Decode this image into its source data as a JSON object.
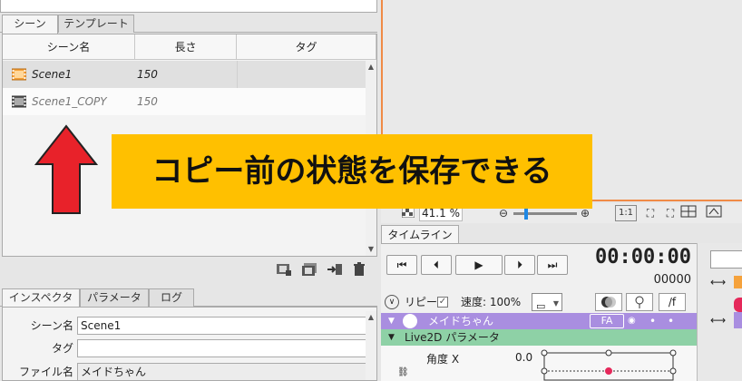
{
  "left_top": {
    "tabs": [
      {
        "label": "シーン"
      },
      {
        "label": "テンプレート"
      }
    ]
  },
  "scene_table": {
    "headers": [
      "シーン名",
      "長さ",
      "タグ"
    ],
    "rows": [
      {
        "name": "Scene1",
        "length": "150",
        "tag": ""
      },
      {
        "name": "Scene1_COPY",
        "length": "150",
        "tag": ""
      }
    ]
  },
  "scene_tools": [
    "film-add-icon",
    "film-copy-icon",
    "import-icon",
    "trash-icon"
  ],
  "inspector": {
    "tabs": [
      {
        "label": "インスペクタ"
      },
      {
        "label": "パラメータ"
      },
      {
        "label": "ログ"
      }
    ],
    "fields": [
      {
        "label": "シーン名",
        "value": "Scene1"
      },
      {
        "label": "タグ",
        "value": ""
      },
      {
        "label": "ファイル名",
        "value": "メイドちゃん"
      }
    ]
  },
  "preview": {
    "zoom": "41.1 %",
    "ratio": "1:1"
  },
  "timeline": {
    "tab": "タイムライン",
    "timecode": "00:00:00",
    "frames": "00000",
    "repeat_label": "リピート",
    "speed_label": "速度: 100%",
    "fps_label": "/f",
    "track_name": "メイドちゃん",
    "track_badge": "FA",
    "group_name": "Live2D パラメータ",
    "param_name": "角度 X",
    "param_value": "0.0"
  },
  "annotation": {
    "text": "コピー前の状態を保存できる"
  },
  "colors": {
    "annotation_bg": "#ffc000",
    "arrow": "#e8222a",
    "track_purple": "#a98ee0",
    "track_green": "#8ed1a6",
    "preview_border": "#f08a46"
  }
}
